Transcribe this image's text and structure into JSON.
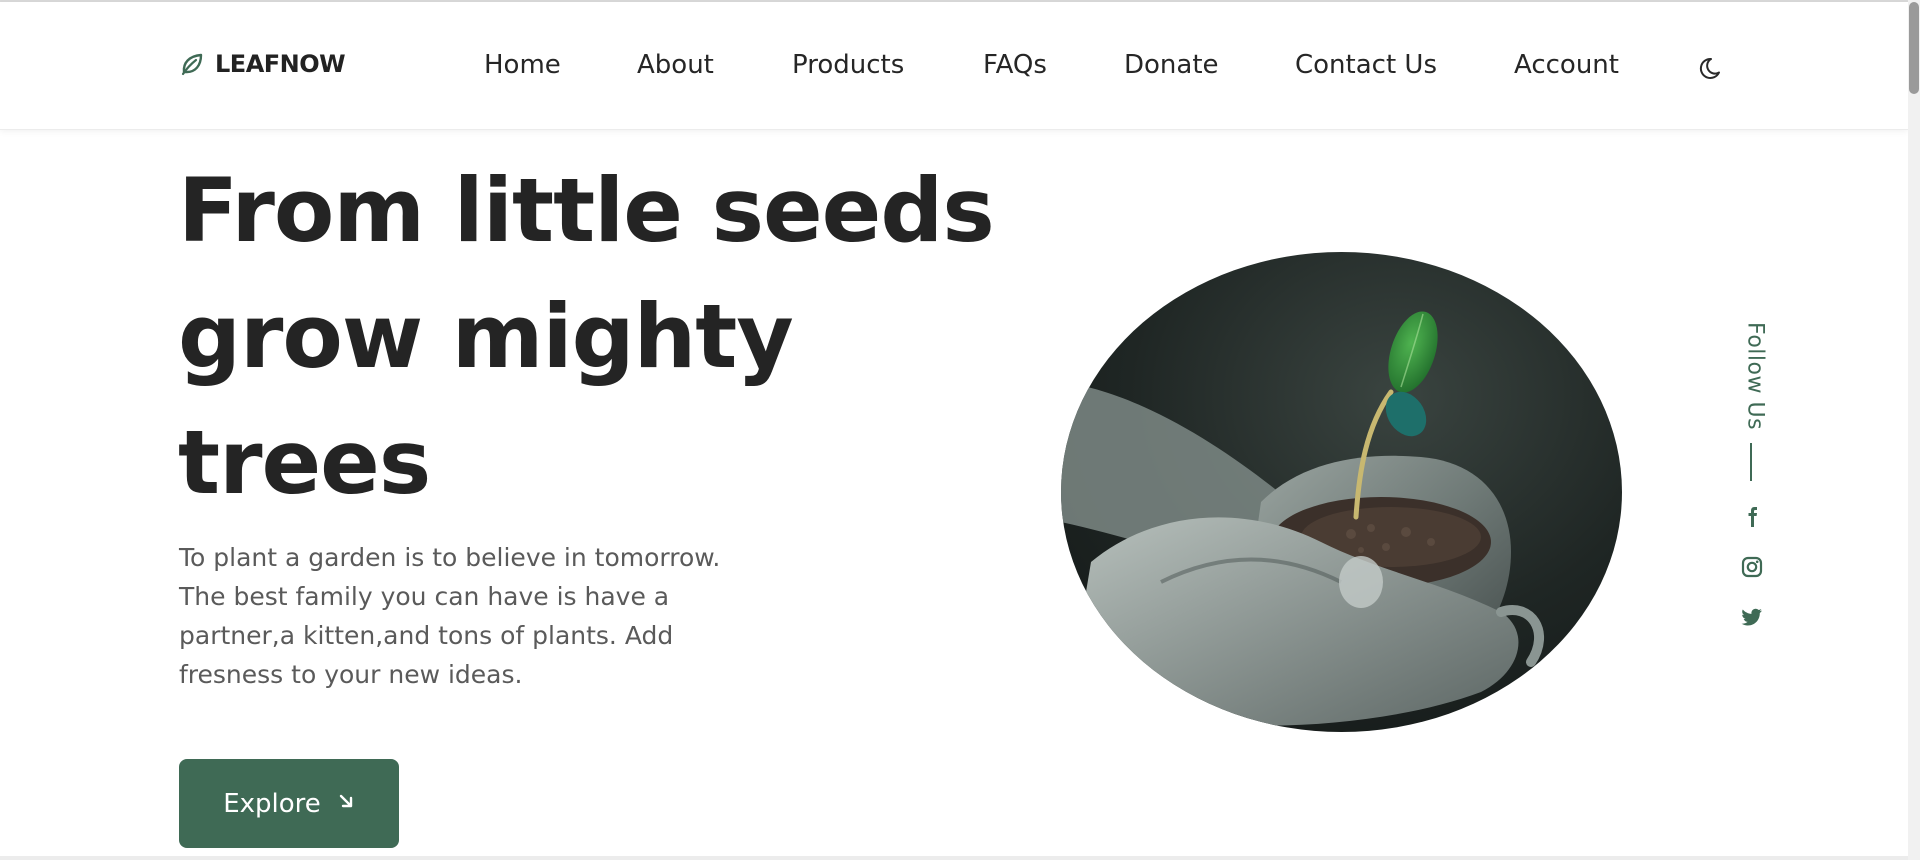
{
  "brand": {
    "name": "LEAFNOW",
    "accent": "#3f6a55"
  },
  "nav": {
    "items": [
      {
        "label": "Home"
      },
      {
        "label": "About"
      },
      {
        "label": "Products"
      },
      {
        "label": "FAQs"
      },
      {
        "label": "Donate"
      },
      {
        "label": "Contact Us"
      },
      {
        "label": "Account"
      }
    ],
    "theme_toggle_icon": "moon-icon"
  },
  "hero": {
    "title_lines": [
      "From little seeds",
      "grow mighty",
      "trees"
    ],
    "subtitle": "To plant a garden is to believe in tomorrow. The best family you can have is have a partner,a kitten,and tons of plants. Add fresness to your new ideas.",
    "cta_label": "Explore",
    "cta_icon": "arrow-down-right-icon",
    "image_subject": "hands-holding-seedling-image"
  },
  "social": {
    "label": "Follow Us",
    "icons": [
      "facebook-icon",
      "instagram-icon",
      "twitter-icon"
    ]
  }
}
